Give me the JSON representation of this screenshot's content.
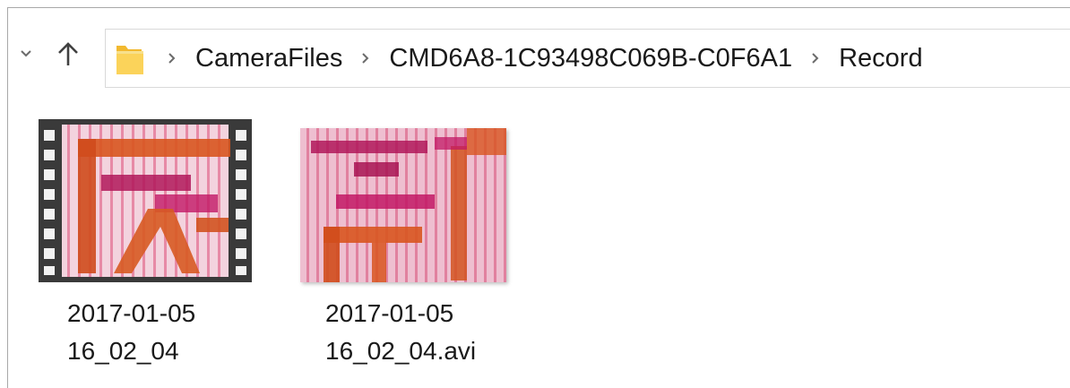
{
  "colors": {
    "window_border": "#a8a8a8",
    "address_border": "#d9d9d9",
    "folder_yellow": "#f7c948",
    "film_frame": "#333333",
    "thumb_pink": "#e8a0b4",
    "thumb_red": "#d9551e",
    "thumb_magenta": "#c21865"
  },
  "nav": {
    "recent_icon": "chevron-down-icon",
    "up_icon": "arrow-up-icon",
    "folder_icon": "folder-icon",
    "separator_icon": "chevron-right-icon"
  },
  "breadcrumb": {
    "items": [
      {
        "label": "CameraFiles"
      },
      {
        "label": "CMD6A8-1C93498C069B-C0F6A1"
      },
      {
        "label": "Record"
      }
    ]
  },
  "files": [
    {
      "line1": "2017-01-05",
      "line2": "16_02_04",
      "thumb_style": "film-strip"
    },
    {
      "line1": "2017-01-05",
      "line2": "16_02_04.avi",
      "thumb_style": "plain"
    }
  ]
}
